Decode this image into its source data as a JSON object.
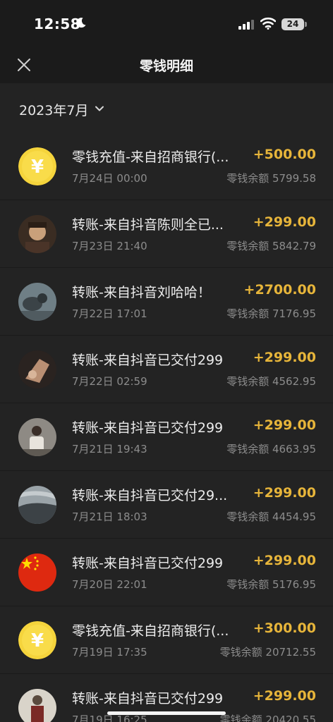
{
  "status_bar": {
    "time": "12:58",
    "battery": "24"
  },
  "nav": {
    "title": "零钱明细"
  },
  "filter": {
    "month": "2023年7月"
  },
  "transactions": [
    {
      "avatar": "yuan-coin-icon",
      "title": "零钱充值-来自招商银行(...",
      "date": "7月24日 00:00",
      "amount": "+500.00",
      "balance": "零钱余额 5799.58"
    },
    {
      "avatar": "user-avatar-1",
      "title": "转账-来自抖音陈则全已...",
      "date": "7月23日 21:40",
      "amount": "+299.00",
      "balance": "零钱余额 5842.79"
    },
    {
      "avatar": "user-avatar-2",
      "title": "转账-来自抖音刘哈哈！",
      "date": "7月22日 17:01",
      "amount": "+2700.00",
      "balance": "零钱余额 7176.95"
    },
    {
      "avatar": "user-avatar-3",
      "title": "转账-来自抖音已交付299",
      "date": "7月22日 02:59",
      "amount": "+299.00",
      "balance": "零钱余额 4562.95"
    },
    {
      "avatar": "user-avatar-4",
      "title": "转账-来自抖音已交付299",
      "date": "7月21日 19:43",
      "amount": "+299.00",
      "balance": "零钱余额 4663.95"
    },
    {
      "avatar": "user-avatar-5",
      "title": "转账-来自抖音已交付29...",
      "date": "7月21日 18:03",
      "amount": "+299.00",
      "balance": "零钱余额 4454.95"
    },
    {
      "avatar": "china-flag-avatar",
      "title": "转账-来自抖音已交付299",
      "date": "7月20日 22:01",
      "amount": "+299.00",
      "balance": "零钱余额 5176.95"
    },
    {
      "avatar": "yuan-coin-icon",
      "title": "零钱充值-来自招商银行(...",
      "date": "7月19日 17:35",
      "amount": "+300.00",
      "balance": "零钱余额 20712.55"
    },
    {
      "avatar": "user-avatar-6",
      "title": "转账-来自抖音已交付299",
      "date": "7月19日 16:25",
      "amount": "+299.00",
      "balance": "零钱余额 20420.55"
    }
  ],
  "colors": {
    "background": "#1b1b1b",
    "row": "#232323",
    "amount": "#e7b53a",
    "secondary_text": "#8c8c8c"
  }
}
